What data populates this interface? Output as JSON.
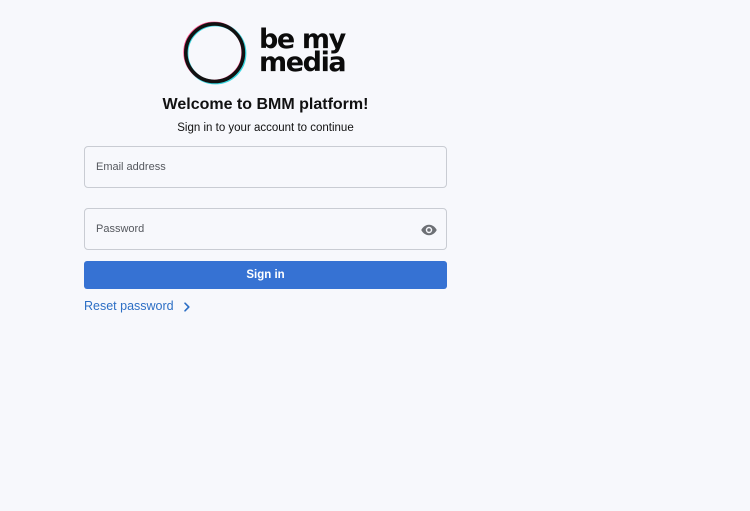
{
  "brand": {
    "logo_text_line1": "be my",
    "logo_text_line2": "media"
  },
  "login": {
    "title": "Welcome to BMM platform!",
    "subtitle": "Sign in to your account to continue",
    "email_placeholder": "Email address",
    "email_value": "",
    "password_placeholder": "Password",
    "password_value": "",
    "submit_label": "Sign in",
    "reset_label": "Reset password"
  },
  "icons": {
    "logo": "circle-logo-icon",
    "password_toggle": "eye-icon",
    "reset_chevron": "chevron-right-icon"
  },
  "colors": {
    "background": "#f7f8fc",
    "primary": "#3672d3",
    "link": "#2d6fc5",
    "border": "#c9ccd3",
    "logo_cyan": "#38d6df",
    "logo_pink": "#ff4f8b"
  }
}
